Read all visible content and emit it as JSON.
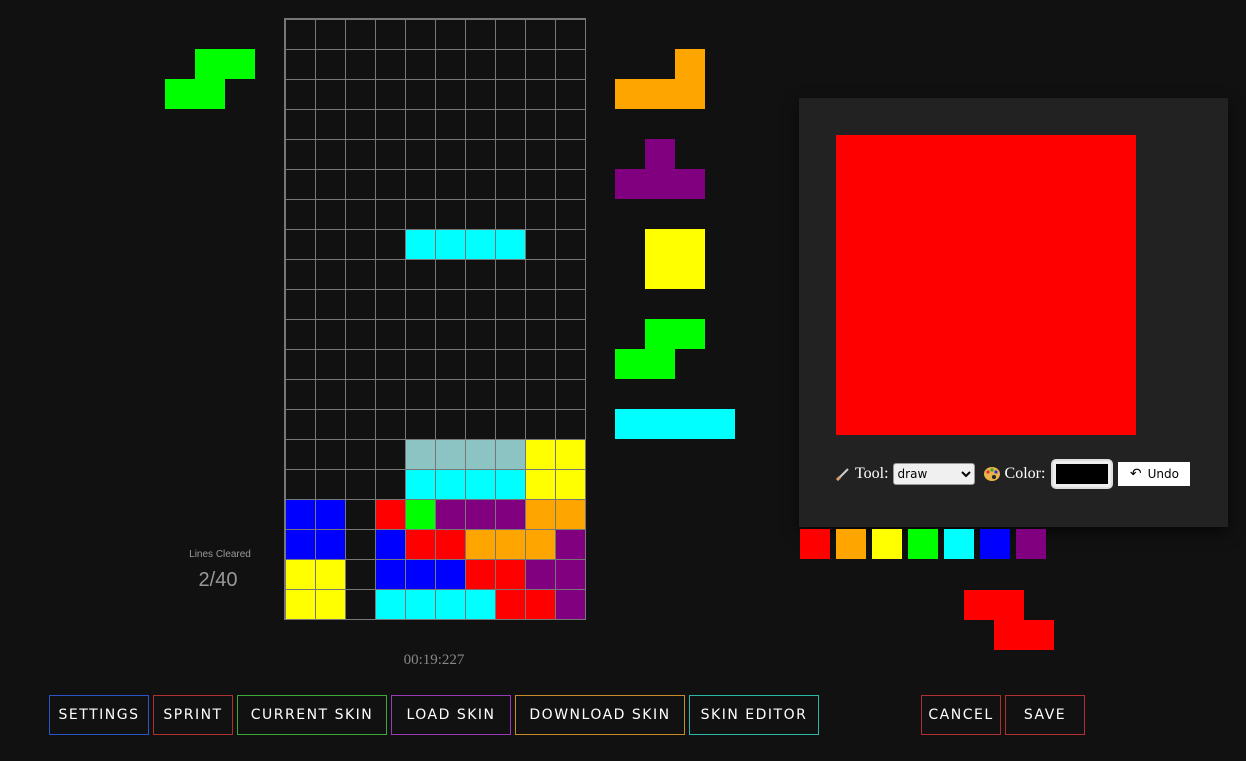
{
  "colors": {
    "background": "#111111",
    "grid_line": "#777777",
    "editor_panel": "#222222",
    "red": "#ff0000",
    "orange": "#ffa500",
    "yellow": "#ffff00",
    "green": "#00ff00",
    "cyan": "#00ffff",
    "blue": "#0000ff",
    "purple": "#800080",
    "ghost": "#8cc4c4"
  },
  "hold_piece": {
    "type": "S",
    "color": "#00ff00"
  },
  "next_queue": [
    {
      "type": "L",
      "color": "#ffa500"
    },
    {
      "type": "T",
      "color": "#800080"
    },
    {
      "type": "O",
      "color": "#ffff00"
    },
    {
      "type": "S",
      "color": "#00ff00"
    },
    {
      "type": "I",
      "color": "#00ffff"
    }
  ],
  "stats": {
    "lines_cleared_label": "Lines Cleared",
    "lines_cleared_value": "2/40",
    "timer": "00:19:227"
  },
  "skin_editor": {
    "tool_label": "Tool:",
    "tool_options": [
      "draw"
    ],
    "tool_selected": "draw",
    "color_label": "Color:",
    "current_color": "#000000",
    "undo_label": "Undo",
    "canvas_color": "#ff0000",
    "palette": [
      "#ff0000",
      "#ffa500",
      "#ffff00",
      "#00ff00",
      "#00ffff",
      "#0000ff",
      "#800080"
    ],
    "preview_piece": {
      "type": "Z",
      "color": "#ff0000"
    }
  },
  "buttons": {
    "settings": "SETTINGS",
    "sprint": "SPRINT",
    "current_skin": "CURRENT SKIN",
    "load_skin": "LOAD SKIN",
    "download_skin": "DOWNLOAD SKIN",
    "skin_editor": "SKIN EDITOR",
    "cancel": "CANCEL",
    "save": "SAVE"
  },
  "button_colors": {
    "settings": "#2a55c8",
    "sprint": "#b03030",
    "current_skin": "#3aa83a",
    "load_skin": "#9a3ab8",
    "download_skin": "#c88a2a",
    "skin_editor": "#2ab8a8",
    "cancel": "#b03030",
    "save": "#b03030"
  },
  "board": {
    "cols": 10,
    "rows": 20,
    "active_piece": {
      "type": "I",
      "color": "#00ffff",
      "col": 4,
      "row": 7
    },
    "ghost_piece": {
      "type": "I",
      "color": "#8cc4c4",
      "col": 4,
      "row": 14
    },
    "cells": [
      {
        "c": 8,
        "r": 14,
        "color": "yellow"
      },
      {
        "c": 9,
        "r": 14,
        "color": "yellow"
      },
      {
        "c": 4,
        "r": 15,
        "color": "cyan"
      },
      {
        "c": 5,
        "r": 15,
        "color": "cyan"
      },
      {
        "c": 6,
        "r": 15,
        "color": "cyan"
      },
      {
        "c": 7,
        "r": 15,
        "color": "cyan"
      },
      {
        "c": 8,
        "r": 15,
        "color": "yellow"
      },
      {
        "c": 9,
        "r": 15,
        "color": "yellow"
      },
      {
        "c": 0,
        "r": 16,
        "color": "blue"
      },
      {
        "c": 1,
        "r": 16,
        "color": "blue"
      },
      {
        "c": 3,
        "r": 16,
        "color": "red"
      },
      {
        "c": 4,
        "r": 16,
        "color": "green"
      },
      {
        "c": 5,
        "r": 16,
        "color": "purple"
      },
      {
        "c": 6,
        "r": 16,
        "color": "purple"
      },
      {
        "c": 7,
        "r": 16,
        "color": "purple"
      },
      {
        "c": 8,
        "r": 16,
        "color": "orange"
      },
      {
        "c": 9,
        "r": 16,
        "color": "orange"
      },
      {
        "c": 0,
        "r": 17,
        "color": "blue"
      },
      {
        "c": 1,
        "r": 17,
        "color": "blue"
      },
      {
        "c": 3,
        "r": 17,
        "color": "blue"
      },
      {
        "c": 4,
        "r": 17,
        "color": "red"
      },
      {
        "c": 5,
        "r": 17,
        "color": "red"
      },
      {
        "c": 6,
        "r": 17,
        "color": "orange"
      },
      {
        "c": 7,
        "r": 17,
        "color": "orange"
      },
      {
        "c": 8,
        "r": 17,
        "color": "orange"
      },
      {
        "c": 9,
        "r": 17,
        "color": "purple"
      },
      {
        "c": 0,
        "r": 18,
        "color": "yellow"
      },
      {
        "c": 1,
        "r": 18,
        "color": "yellow"
      },
      {
        "c": 3,
        "r": 18,
        "color": "blue"
      },
      {
        "c": 4,
        "r": 18,
        "color": "blue"
      },
      {
        "c": 5,
        "r": 18,
        "color": "blue"
      },
      {
        "c": 6,
        "r": 18,
        "color": "red"
      },
      {
        "c": 7,
        "r": 18,
        "color": "red"
      },
      {
        "c": 8,
        "r": 18,
        "color": "purple"
      },
      {
        "c": 9,
        "r": 18,
        "color": "purple"
      },
      {
        "c": 0,
        "r": 19,
        "color": "yellow"
      },
      {
        "c": 1,
        "r": 19,
        "color": "yellow"
      },
      {
        "c": 3,
        "r": 19,
        "color": "cyan"
      },
      {
        "c": 4,
        "r": 19,
        "color": "cyan"
      },
      {
        "c": 5,
        "r": 19,
        "color": "cyan"
      },
      {
        "c": 6,
        "r": 19,
        "color": "cyan"
      },
      {
        "c": 7,
        "r": 19,
        "color": "red"
      },
      {
        "c": 8,
        "r": 19,
        "color": "red"
      },
      {
        "c": 9,
        "r": 19,
        "color": "purple"
      }
    ]
  }
}
